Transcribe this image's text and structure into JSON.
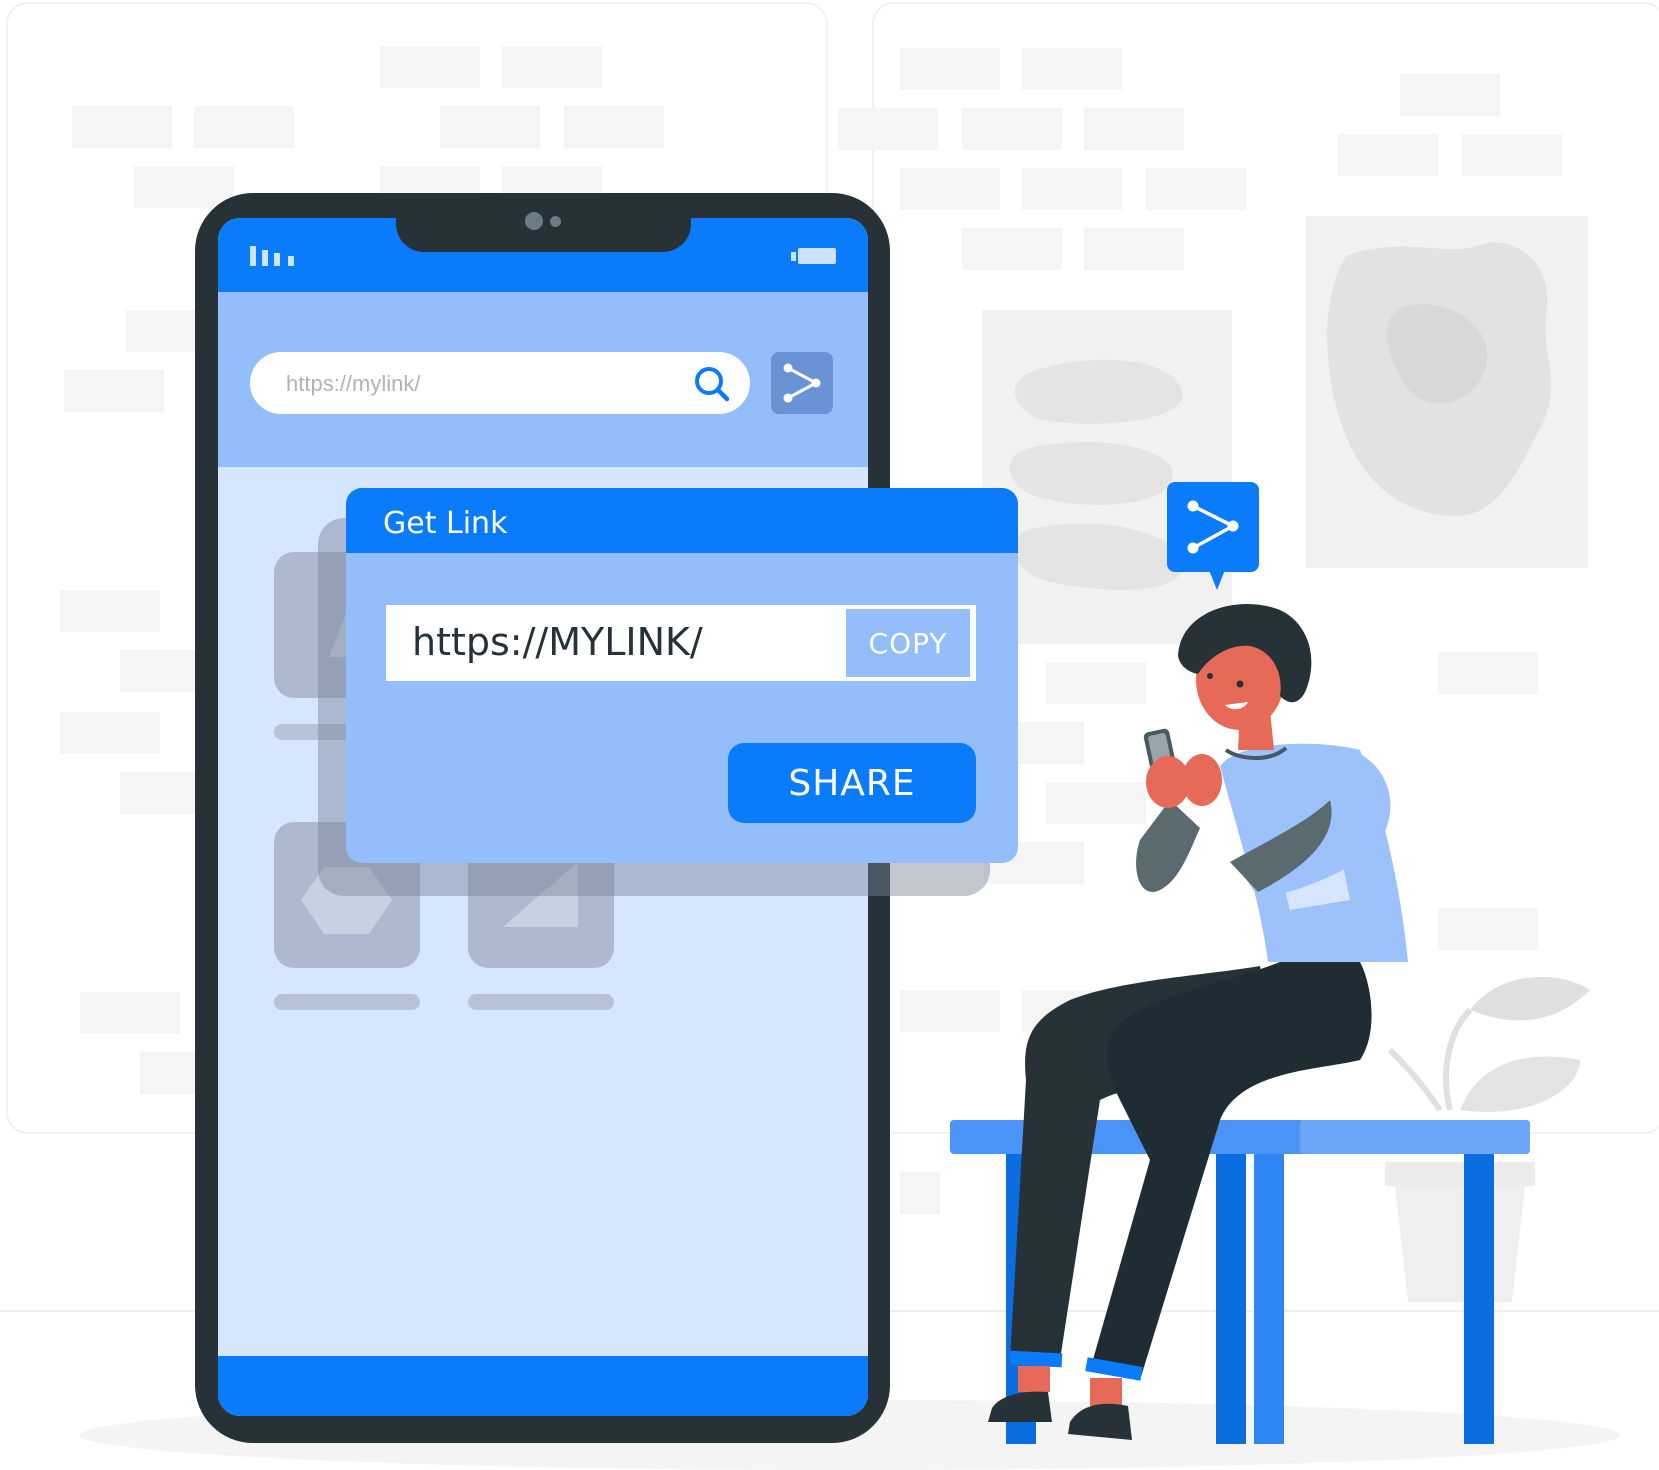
{
  "browser": {
    "url_placeholder": "https://mylink/"
  },
  "dialog": {
    "title": "Get Link",
    "link_value": "https://MYLINK/",
    "copy_label": "COPY",
    "share_label": "SHARE"
  },
  "colors": {
    "primary": "#0a7bfb",
    "light_blue": "#94bdfb",
    "screen_bg": "#d6e6ff",
    "phone_body": "#263238"
  },
  "icons": [
    "signal-icon",
    "battery-icon",
    "search-icon",
    "share-icon",
    "share-bubble-icon"
  ]
}
